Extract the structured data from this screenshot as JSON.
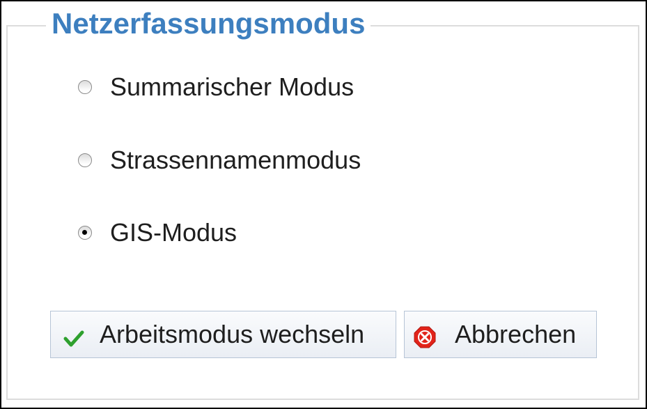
{
  "dialog": {
    "legend": "Netzerfassungsmodus"
  },
  "options": [
    {
      "label": "Summarischer Modus",
      "checked": false
    },
    {
      "label": "Strassennamenmodus",
      "checked": false
    },
    {
      "label": "GIS-Modus",
      "checked": true
    }
  ],
  "buttons": {
    "switch_label": "Arbeitsmodus wechseln",
    "switch_icon": "checkmark-icon",
    "cancel_label": "Abbrechen",
    "cancel_icon": "cancel-icon"
  },
  "colors": {
    "legend": "#3d7fbf",
    "checkmark": "#2ea02e",
    "cancel": "#e2231a"
  }
}
